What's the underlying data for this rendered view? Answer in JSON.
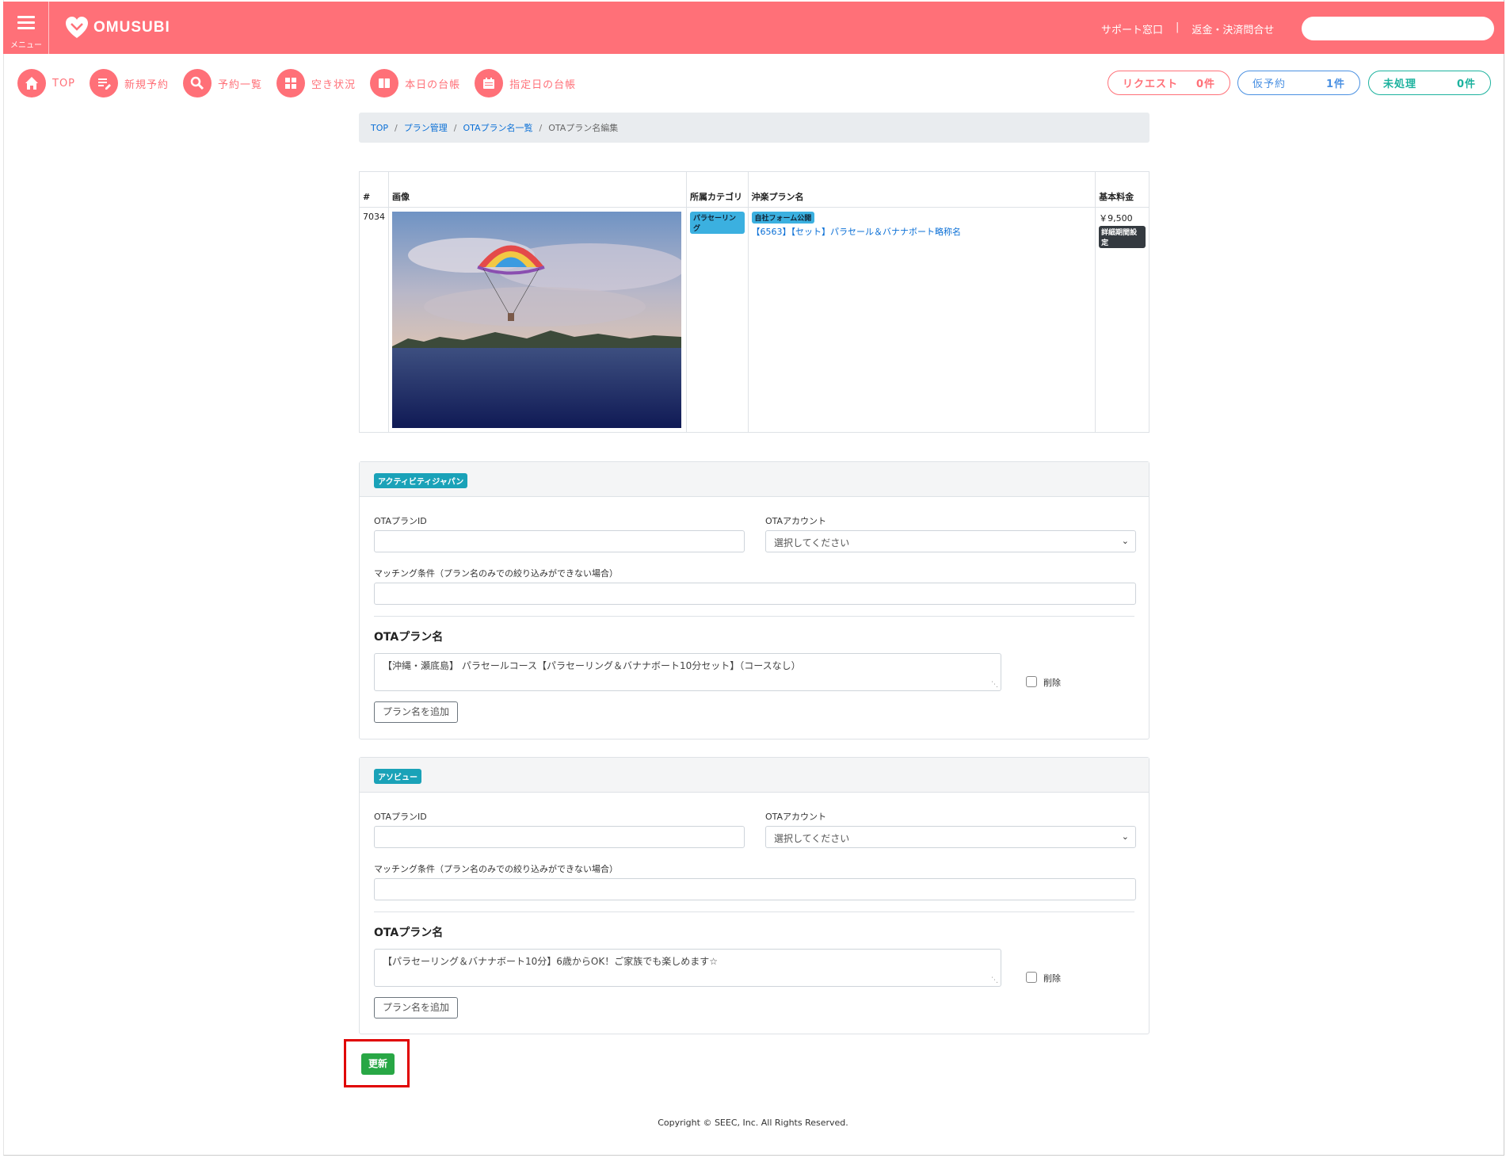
{
  "header": {
    "menu_label": "メニュー",
    "logo_text": "OMUSUBI",
    "support_link": "サポート窓口",
    "separator": "|",
    "refund_link": "返金・決済問合せ",
    "search_placeholder": ""
  },
  "nav": {
    "items": [
      {
        "label": "TOP",
        "icon": "home-icon"
      },
      {
        "label": "新規予約",
        "icon": "edit-icon"
      },
      {
        "label": "予約一覧",
        "icon": "search-icon"
      },
      {
        "label": "空き状況",
        "icon": "grid-icon"
      },
      {
        "label": "本日の台帳",
        "icon": "book-icon"
      },
      {
        "label": "指定日の台帳",
        "icon": "calendar-icon"
      }
    ]
  },
  "status_pills": {
    "request": {
      "label": "リクエスト",
      "count": "0件"
    },
    "tentative": {
      "label": "仮予約",
      "count": "1件"
    },
    "unprocessed": {
      "label": "未処理",
      "count": "0件"
    }
  },
  "breadcrumb": {
    "items": [
      "TOP",
      "プラン管理",
      "OTAプラン名一覧"
    ],
    "current": "OTAプラン名編集",
    "sep": "/"
  },
  "plan_table": {
    "headers": {
      "id": "#",
      "image": "画像",
      "category": "所属カテゴリ",
      "name": "沖楽プラン名",
      "price": "基本料金"
    },
    "row": {
      "id": "7034",
      "category_badge": "パラセーリング",
      "form_badge": "自社フォーム公開",
      "plan_name": "【6563】【セット】パラセール＆バナナボート略称名",
      "price": "￥9,500",
      "price_badge": "詳細期間設定"
    }
  },
  "cards": [
    {
      "tag": "アクティビティジャパン",
      "ota_plan_id_label": "OTAプランID",
      "ota_plan_id_value": "",
      "ota_account_label": "OTAアカウント",
      "ota_account_value": "選択してください",
      "matching_label": "マッチング条件（プラン名のみでの絞り込みができない場合）",
      "matching_value": "",
      "section_title": "OTAプラン名",
      "plan_name_value": "【沖縄・瀬底島】 パラセールコース【パラセーリング＆バナナボート10分セット】（コースなし）",
      "delete_label": "削除",
      "add_button": "プラン名を追加"
    },
    {
      "tag": "アソビュー",
      "ota_plan_id_label": "OTAプランID",
      "ota_plan_id_value": "",
      "ota_account_label": "OTAアカウント",
      "ota_account_value": "選択してください",
      "matching_label": "マッチング条件（プラン名のみでの絞り込みができない場合）",
      "matching_value": "",
      "section_title": "OTAプラン名",
      "plan_name_value": "【パラセーリング＆バナナボート10分】6歳からOK！ご家族でも楽しめます☆",
      "delete_label": "削除",
      "add_button": "プラン名を追加"
    }
  ],
  "submit_button": "更新",
  "footer": "Copyright © SEEC, Inc. All Rights Reserved.",
  "colors": {
    "brand": "#ff7078",
    "link": "#0a6fd6",
    "tentative": "#4a90e2",
    "unprocessed": "#1cb29e",
    "submit": "#28a745",
    "highlight": "#e00000"
  }
}
